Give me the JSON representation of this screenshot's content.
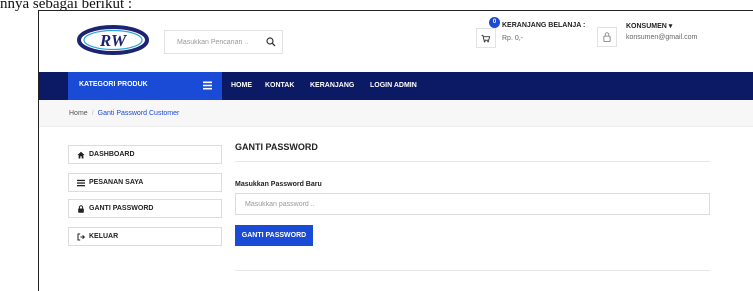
{
  "caption": "nnya sebagai berikut :",
  "colors": {
    "accent": "#1a4bd6",
    "nav_background": "#0c1a66",
    "breadcrumb_background": "#f7f7f7"
  },
  "header": {
    "logo_text": "RW",
    "search": {
      "placeholder": "Masukkan Pencarian ..",
      "icon": "search-icon"
    },
    "cart": {
      "icon": "cart-icon",
      "count": "0",
      "title": "KERANJANG BELANJA :",
      "total": "Rp. 0,-"
    },
    "user": {
      "icon": "user-icon",
      "name": "KONSUMEN ▾",
      "email": "konsumen@gmail.com"
    }
  },
  "nav": {
    "category_label": "KATEGORI PRODUK",
    "category_icon": "list-icon",
    "links": [
      "HOME",
      "KONTAK",
      "KERANJANG",
      "LOGIN ADMIN"
    ]
  },
  "breadcrumb": {
    "home": "Home",
    "separator": "/",
    "current": "Ganti Password Customer"
  },
  "sidebar": {
    "items": [
      {
        "label": "DASHBOARD",
        "icon": "home-icon"
      },
      {
        "label": "PESANAN SAYA",
        "icon": "list-icon"
      },
      {
        "label": "GANTI PASSWORD",
        "icon": "lock-icon"
      },
      {
        "label": "KELUAR",
        "icon": "logout-icon"
      }
    ]
  },
  "main": {
    "title": "GANTI PASSWORD",
    "field_label": "Masukkan Password Baru",
    "field_placeholder": "Masukkan password ..",
    "field_value": "",
    "submit_label": "GANTI PASSWORD"
  }
}
